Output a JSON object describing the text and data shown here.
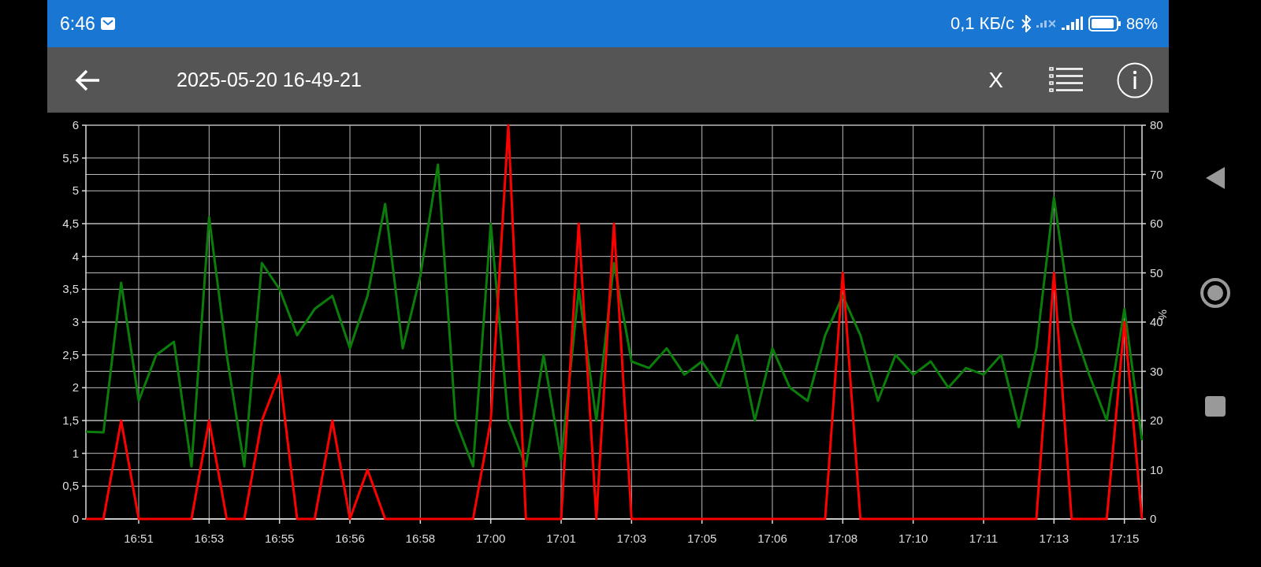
{
  "status_bar": {
    "time": "6:46",
    "speed": "0,1 КБ/с",
    "battery": "86%"
  },
  "toolbar": {
    "title": "2025-05-20 16-49-21",
    "close": "X"
  },
  "chart": {
    "chart_data": {
      "type": "line",
      "categories": [
        null,
        null,
        null,
        "16:51",
        null,
        null,
        null,
        "16:53",
        null,
        null,
        null,
        "16:55",
        null,
        null,
        null,
        "16:56",
        null,
        null,
        null,
        "16:58",
        null,
        null,
        null,
        "17:00",
        null,
        null,
        null,
        "17:01",
        null,
        null,
        null,
        "17:03",
        null,
        null,
        null,
        "17:05",
        null,
        null,
        null,
        "17:06",
        null,
        null,
        null,
        "17:08",
        null,
        null,
        null,
        "17:10",
        null,
        null,
        null,
        "17:11",
        null,
        null,
        null,
        "17:13",
        null,
        null,
        null,
        "17:15",
        null
      ],
      "series": [
        {
          "color": "#0a7d0a",
          "values": [
            1.33,
            1.32,
            3.6,
            1.8,
            2.5,
            2.7,
            0.8,
            4.6,
            2.5,
            0.8,
            3.9,
            3.5,
            2.8,
            3.2,
            3.4,
            2.6,
            3.4,
            4.8,
            2.6,
            3.7,
            5.4,
            1.5,
            0.8,
            4.5,
            1.5,
            0.8,
            2.5,
            0.9,
            3.5,
            1.5,
            3.9,
            2.4,
            2.3,
            2.6,
            2.2,
            2.4,
            2.0,
            2.8,
            1.5,
            2.6,
            2.0,
            1.8,
            2.8,
            3.4,
            2.8,
            1.8,
            2.5,
            2.2,
            2.4,
            2.0,
            2.3,
            2.2,
            2.5,
            1.4,
            2.6,
            4.9,
            3.0,
            2.2,
            1.5,
            3.2,
            1.2
          ]
        },
        {
          "color": "#ff0000",
          "values": [
            0,
            0,
            1.5,
            0,
            0,
            0,
            0,
            1.5,
            0,
            0,
            1.5,
            2.2,
            0,
            0,
            1.5,
            0,
            0.75,
            0,
            0,
            0,
            0,
            0,
            0,
            1.5,
            6,
            0,
            0,
            0,
            4.5,
            0,
            4.5,
            0,
            0,
            0,
            0,
            0,
            0,
            0,
            0,
            0,
            0,
            0,
            0,
            3.75,
            0,
            0,
            0,
            0,
            0,
            0,
            0,
            0,
            0,
            0,
            0,
            3.75,
            0,
            0,
            0,
            3,
            0
          ]
        }
      ],
      "ylim": [
        0,
        6
      ],
      "grid": true,
      "yticks": [
        0,
        {
          "value": 0.5,
          "label": "0,5"
        },
        1,
        {
          "value": 1.5,
          "label": "1,5"
        },
        2,
        {
          "value": 2.5,
          "label": "2,5"
        },
        3,
        {
          "value": 3.5,
          "label": "3,5"
        },
        4,
        {
          "value": 4.5,
          "label": "4,5"
        },
        5,
        {
          "value": 5.5,
          "label": "5,5"
        },
        6
      ]
    },
    "right_axis": {
      "label": "%",
      "ticks": [
        "80",
        "70",
        "60",
        "50",
        "40",
        "30",
        "20",
        "10",
        "0"
      ]
    }
  }
}
